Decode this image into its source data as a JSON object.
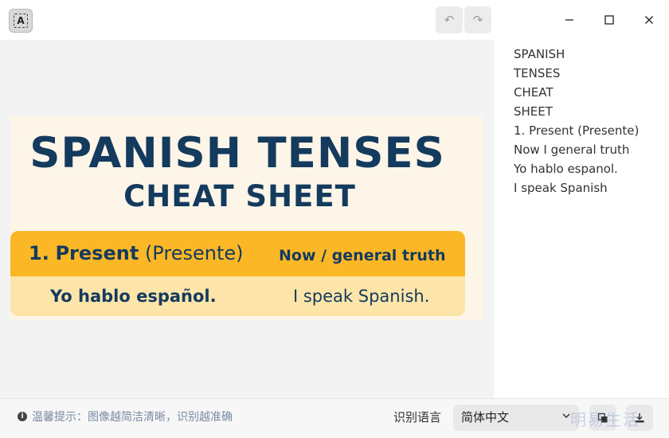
{
  "titlebar": {
    "app_icon_glyph": "A",
    "undo_glyph": "↶",
    "redo_glyph": "↷"
  },
  "cheat_sheet": {
    "title": "SPANISH TENSES",
    "subtitle": "CHEAT SHEET",
    "tense_number": "1.",
    "tense_name": "Present",
    "tense_spanish": "(Presente)",
    "tense_use": "Now / general truth",
    "example_spanish": "Yo hablo español.",
    "example_english": "I speak Spanish.",
    "colors": {
      "navy": "#143a5e",
      "header_yellow": "#fbb726",
      "row_yellow": "#fde4a8",
      "background": "#fdf5e8"
    }
  },
  "ocr_result": {
    "lines": [
      "SPANISH",
      "TENSES",
      "CHEAT",
      "SHEET",
      "1. Present (Presente)",
      "Now I general truth",
      "Yo hablo espanol.",
      "I speak Spanish"
    ]
  },
  "footer": {
    "tip": "温馨提示：图像越简洁清晰，识别越准确",
    "language_label": "识别语言",
    "language_value": "简体中文",
    "watermark": "明易生活"
  },
  "icons": {
    "app": "text-recognition-icon",
    "undo": "undo-icon",
    "redo": "redo-icon",
    "minimize": "minimize-icon",
    "maximize": "maximize-icon",
    "close": "close-icon",
    "info": "info-icon",
    "chevron": "chevron-down-icon",
    "copy": "copy-icon",
    "download": "download-icon"
  }
}
